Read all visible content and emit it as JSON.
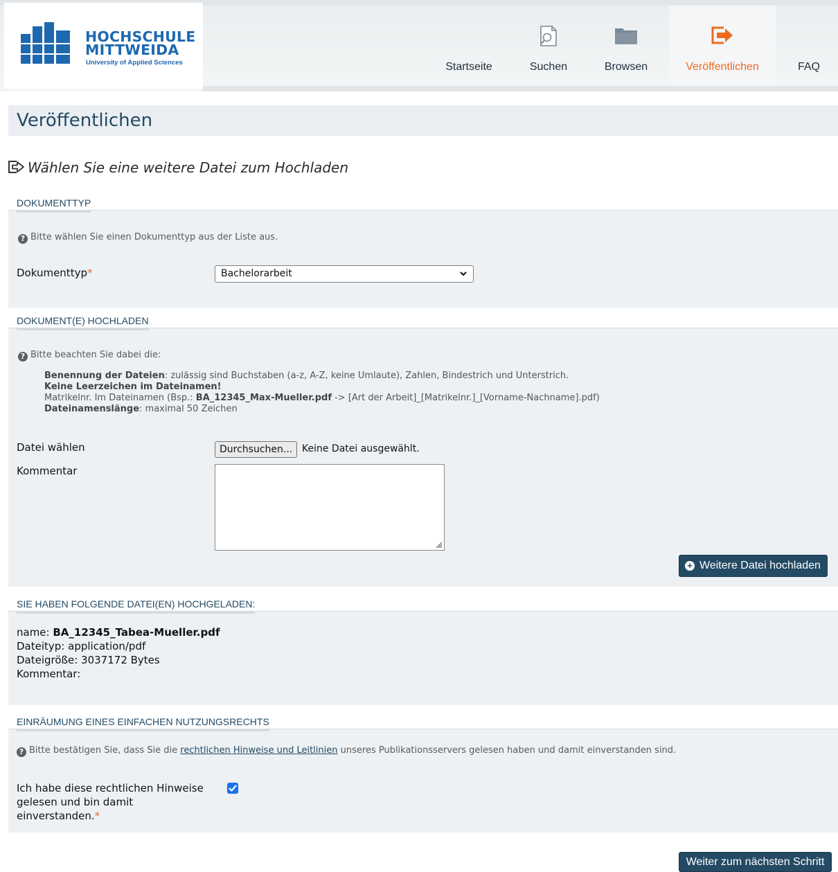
{
  "header": {
    "logo_title_line1": "HOCHSCHULE",
    "logo_title_line2": "MITTWEIDA",
    "logo_subtitle": "University of Applied Sciences",
    "nav": [
      {
        "label": "Startseite",
        "icon": ""
      },
      {
        "label": "Suchen",
        "icon": "search-document-icon"
      },
      {
        "label": "Browsen",
        "icon": "folder-icon"
      },
      {
        "label": "Veröffentlichen",
        "icon": "publish-arrow-icon",
        "active": true
      },
      {
        "label": "FAQ",
        "icon": ""
      }
    ]
  },
  "page": {
    "title": "Veröffentlichen",
    "subtitle": "Wählen Sie eine weitere Datei zum Hochladen"
  },
  "doctype": {
    "legend": "DOKUMENTTYP",
    "help": "Bitte wählen Sie einen Dokumenttyp aus der Liste aus.",
    "label": "Dokumenttyp",
    "required_marker": "*",
    "selected": "Bachelorarbeit"
  },
  "upload": {
    "legend": "DOKUMENT(E) HOCHLADEN",
    "help": "Bitte beachten Sie dabei die:",
    "rule1_bold": "Benennung der Dateien",
    "rule1_text": ": zulässig sind Buchstaben (a-z, A-Z, keine Umlaute), Zahlen, Bindestrich und Unterstrich.",
    "rule2_bold": "Keine Leerzeichen im Dateinamen!",
    "rule3_prefix": "Matrikelnr. Im Dateinamen (Bsp.: ",
    "rule3_bold": "BA_12345_Max-Mueller.pdf",
    "rule3_suffix": " -> [Art der Arbeit]_[Matrikelnr.]_[Vorname-Nachname].pdf)",
    "rule4_bold": "Dateinamenslänge",
    "rule4_text": ": maximal 50 Zeichen",
    "file_label": "Datei wählen",
    "browse_button": "Durchsuchen...",
    "file_status": "Keine Datei ausgewählt.",
    "comment_label": "Kommentar",
    "comment_value": "",
    "add_button": "Weitere Datei hochladen"
  },
  "uploaded": {
    "legend": "SIE HABEN FOLGENDE DATEI(EN) HOCHGELADEN:",
    "name_label": "name:",
    "name_value": "BA_12345_Tabea-Mueller.pdf",
    "type_line": "Dateityp: application/pdf",
    "size_line": "Dateigröße: 3037172 Bytes",
    "comment_line": "Kommentar:"
  },
  "rights": {
    "legend": "EINRÄUMUNG EINES EINFACHEN NUTZUNGSRECHTS",
    "help_prefix": "Bitte bestätigen Sie, dass Sie die ",
    "help_link": "rechtlichen Hinweise und Leitlinien",
    "help_suffix": " unseres Publikationsservers gelesen haben und damit einverstanden sind.",
    "agree_label": "Ich habe diese rechtlichen Hinweise gelesen und bin damit einverstanden.",
    "required_marker": "*",
    "checked": true
  },
  "footer": {
    "next_button": "Weiter zum nächsten Schritt"
  },
  "colors": {
    "brand_blue": "#1e68b0",
    "accent_orange": "#ef6a1d",
    "button_blue": "#244a64",
    "checkbox_blue": "#1a73e8"
  }
}
